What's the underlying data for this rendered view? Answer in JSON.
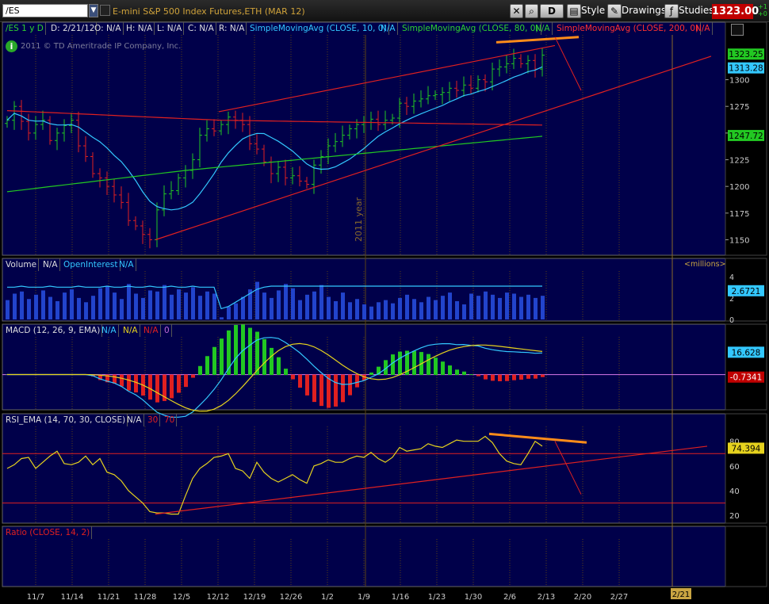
{
  "toolbar": {
    "symbol": "/ES",
    "description": "E-mini S&P 500 Index Futures,ETH (MAR 12)",
    "d_label": "D",
    "style": "Style",
    "drawings": "Drawings",
    "studies": "Studies",
    "last_price": "1323.00",
    "change_up": "+1",
    "change_down": "+0"
  },
  "chart_header": {
    "symbol_period": "/ES 1 y D",
    "date": "D: 2/21/12",
    "open": "O: N/A",
    "high": "H: N/A",
    "low": "L: N/A",
    "close": "C: N/A",
    "range": "R: N/A",
    "sma10": "SimpleMovingAvg (CLOSE, 10, 0)",
    "sma10_val": "N/A",
    "sma80": "SimpleMovingAvg (CLOSE, 80, 0)",
    "sma80_val": "N/A",
    "sma200": "SimpleMovingAvg (CLOSE, 200, 0)",
    "sma200_val": "N/A"
  },
  "watermark": "2011 © TD Ameritrade IP Company, Inc.",
  "year_label": "2011 year",
  "volume_header": {
    "label": "Volume",
    "val": "N/A",
    "oi": "OpenInterest",
    "oi_val": "N/A",
    "units": "<millions>"
  },
  "macd_header": {
    "label": "MACD (12, 26, 9, EMA)",
    "v1": "N/A",
    "v2": "N/A",
    "v3": "N/A",
    "v4": "0"
  },
  "rsi_header": {
    "label": "RSI_EMA (14, 70, 30, CLOSE)",
    "v1": "N/A",
    "v2": "30",
    "v3": "70"
  },
  "ratio_header": {
    "label": "Ratio (CLOSE, 14, 2)"
  },
  "current_date_tag": "2/21",
  "colors": {
    "background": "#00004a",
    "grid": "#5a4216",
    "price_up": "#22c822",
    "price_down": "#e02020",
    "sma10": "#33c8ff",
    "sma80": "#22c822",
    "sma200": "#e02020",
    "trendline": "#e02020",
    "divergence": "#ff8c1a",
    "volume": "#2244cc",
    "macd_signal": "#e6d21e",
    "rsi": "#e6d21e"
  },
  "chart_data": [
    {
      "type": "candlestick",
      "panel": "price",
      "x_ticks": [
        "11/7",
        "11/14",
        "11/21",
        "11/28",
        "12/5",
        "12/12",
        "12/19",
        "12/26",
        "1/2",
        "1/9",
        "1/16",
        "1/23",
        "1/30",
        "2/6",
        "2/13",
        "2/20",
        "2/27"
      ],
      "y_ticks": [
        1150,
        1175,
        1200,
        1225,
        1250,
        1275,
        1300
      ],
      "ylim": [
        1137,
        1342
      ],
      "closes": [
        1262,
        1275,
        1261,
        1250,
        1258,
        1262,
        1243,
        1250,
        1257,
        1262,
        1238,
        1228,
        1212,
        1208,
        1200,
        1192,
        1185,
        1168,
        1163,
        1155,
        1150,
        1178,
        1193,
        1196,
        1208,
        1215,
        1225,
        1248,
        1254,
        1252,
        1258,
        1265,
        1262,
        1258,
        1240,
        1235,
        1223,
        1212,
        1218,
        1208,
        1210,
        1205,
        1202,
        1220,
        1228,
        1238,
        1242,
        1248,
        1254,
        1258,
        1260,
        1263,
        1258,
        1262,
        1264,
        1278,
        1275,
        1280,
        1282,
        1285,
        1286,
        1288,
        1292,
        1290,
        1295,
        1292,
        1300,
        1298,
        1310,
        1312,
        1315,
        1320,
        1315,
        1318,
        1310,
        1323
      ],
      "series": [
        {
          "name": "SimpleMovingAvg (CLOSE, 10, 0)",
          "end_value": 1313.28
        },
        {
          "name": "SimpleMovingAvg (CLOSE, 80, 0)",
          "end_value": 1247.72
        },
        {
          "name": "SimpleMovingAvg (CLOSE, 200, 0)"
        }
      ],
      "price_labels": [
        "1323.25",
        "1313.28",
        "1247.72"
      ]
    },
    {
      "type": "bar",
      "panel": "volume",
      "y_ticks": [
        0,
        2,
        4
      ],
      "ylim": [
        0,
        4.5
      ],
      "value_label": "2.6721",
      "values": [
        1.8,
        2.4,
        2.6,
        1.9,
        2.3,
        2.7,
        2.1,
        1.7,
        2.5,
        2.8,
        2.0,
        1.6,
        2.2,
        2.9,
        3.1,
        2.5,
        1.9,
        3.3,
        2.4,
        2.0,
        2.7,
        2.6,
        3.2,
        2.3,
        2.8,
        2.5,
        3.0,
        2.2,
        2.6,
        2.4,
        0.2,
        1.2,
        1.5,
        2.1,
        2.8,
        3.5,
        2.5,
        2.0,
        2.7,
        3.3,
        2.9,
        1.8,
        2.3,
        2.6,
        3.2,
        2.1,
        1.7,
        2.5,
        1.6,
        1.9,
        1.4,
        1.2,
        1.6,
        1.8,
        1.5,
        2.0,
        2.3,
        1.9,
        1.6,
        2.1,
        1.8,
        2.2,
        2.5,
        1.7,
        1.4,
        2.4,
        2.2,
        2.6,
        2.3,
        2.0,
        2.5,
        2.4,
        2.1,
        2.3,
        2.0,
        2.2
      ],
      "open_interest": [
        3.0,
        3.0,
        3.1,
        3.0,
        3.0,
        3.0,
        3.1,
        3.0,
        3.0,
        3.0,
        3.1,
        3.0,
        3.0,
        3.0,
        3.1,
        3.0,
        3.0,
        3.1,
        3.0,
        3.0,
        3.1,
        3.0,
        3.0,
        3.1,
        3.0,
        3.0,
        3.1,
        3.0,
        3.0,
        3.0,
        1.0,
        1.2,
        1.6,
        2.0,
        2.4,
        2.8,
        3.0,
        3.1,
        3.1,
        3.1,
        3.1,
        3.1,
        3.1,
        3.1,
        3.1,
        3.1,
        3.1,
        3.1,
        3.1,
        3.1,
        3.1,
        3.1,
        3.1,
        3.1,
        3.1,
        3.1,
        3.1,
        3.1,
        3.1,
        3.1,
        3.1,
        3.1,
        3.1,
        3.1,
        3.1,
        3.1,
        3.1,
        3.1,
        3.1,
        3.1,
        3.1,
        3.1,
        3.1,
        3.1,
        3.1,
        3.1
      ]
    },
    {
      "type": "bar",
      "panel": "macd",
      "series": [
        {
          "name": "MACD (12, 26, 9, EMA)",
          "value_label": "16.628"
        },
        {
          "value_label": "-0.7341"
        }
      ],
      "ylim": [
        -25,
        28
      ],
      "zero_line": 0
    },
    {
      "type": "line",
      "panel": "rsi",
      "y_ticks": [
        20,
        40,
        60,
        80
      ],
      "ylim": [
        15,
        92
      ],
      "overbought": 70,
      "oversold": 30,
      "value_label": "74.394",
      "values": [
        58,
        61,
        66,
        67,
        58,
        63,
        68,
        72,
        62,
        61,
        63,
        68,
        61,
        66,
        55,
        53,
        48,
        40,
        35,
        30,
        23,
        22,
        22,
        21,
        21,
        36,
        50,
        58,
        62,
        67,
        68,
        70,
        58,
        56,
        50,
        63,
        55,
        50,
        47,
        50,
        53,
        49,
        46,
        60,
        62,
        65,
        63,
        63,
        66,
        68,
        67,
        71,
        66,
        63,
        67,
        75,
        72,
        73,
        74,
        78,
        76,
        75,
        78,
        81,
        80,
        80,
        80,
        84,
        79,
        70,
        64,
        62,
        61,
        70,
        80,
        76
      ]
    },
    {
      "type": "line",
      "panel": "ratio",
      "title": "Ratio (CLOSE, 14, 2)"
    }
  ]
}
